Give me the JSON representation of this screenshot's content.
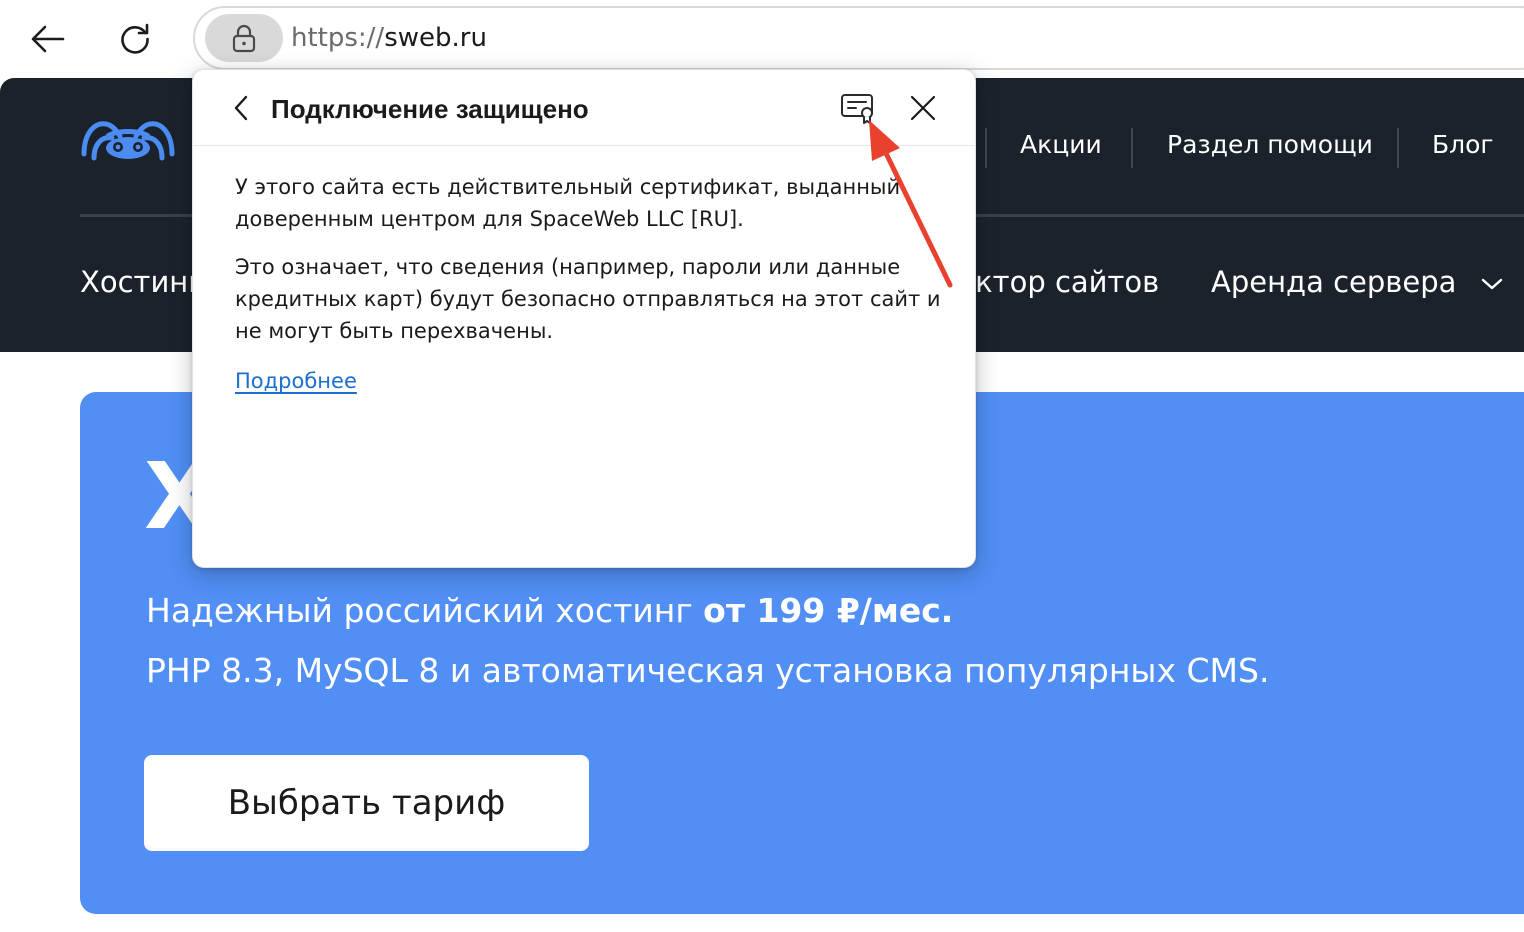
{
  "browser": {
    "url_scheme": "https://",
    "url_host": "sweb.ru"
  },
  "site": {
    "top_nav": [
      "Акции",
      "Раздел помощи",
      "Блог"
    ],
    "main_nav": {
      "hosting_partial": "Хостинг",
      "constructor_partial": "уктор сайтов",
      "server_rent": "Аренда сервера"
    }
  },
  "hero": {
    "title_partial": "Х",
    "line1_prefix": "Надежный российский хостинг ",
    "line1_bold": "от 199 ₽/мес.",
    "line2": "PHP 8.3, MySQL 8 и автоматическая установка популярных CMS.",
    "cta_label": "Выбрать тариф"
  },
  "popover": {
    "title": "Подключение защищено",
    "paragraph1": "У этого сайта есть действительный сертификат, выданный доверенным центром для SpaceWeb LLC [RU].",
    "paragraph2": "Это означает, что сведения (например, пароли или данные кредитных карт) будут безопасно отправляться на этот сайт и не могут быть перехвачены.",
    "more_link": "Подробнее"
  },
  "colors": {
    "header_bg": "#1c222b",
    "hero_bg": "#518ff5",
    "link": "#1a6fd1",
    "annotation_arrow": "#e8422e",
    "logo": "#4a8cf2"
  },
  "icons": {
    "back": "arrow-left-icon",
    "reload": "reload-icon",
    "lock": "lock-icon",
    "certificate": "certificate-icon",
    "close": "close-icon",
    "chevron": "chevron-down-icon"
  }
}
